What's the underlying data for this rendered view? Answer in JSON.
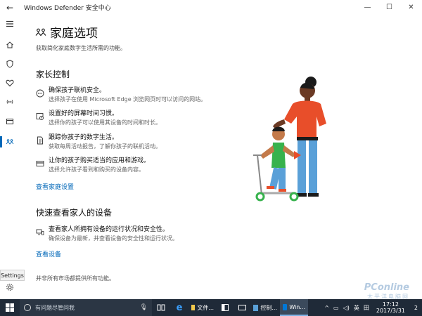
{
  "window": {
    "title": "Windows Defender 安全中心",
    "back_glyph": "←",
    "min_glyph": "—",
    "max_glyph": "☐",
    "close_glyph": "✕"
  },
  "rail": {
    "items": [
      "menu-icon",
      "home-icon",
      "shield-icon",
      "heart-icon",
      "wifi-icon",
      "browser-icon",
      "family-icon"
    ],
    "active_index": 6,
    "settings_tooltip": "Settings"
  },
  "page": {
    "title": "家庭选项",
    "subtitle": "获取简化家庭数字生活所需的功能。"
  },
  "parental": {
    "title": "家长控制",
    "items": [
      {
        "icon": "ellipsis-circle-icon",
        "title": "确保孩子联机安全。",
        "desc": "选择孩子在使用 Microsoft Edge 浏览网页时可以访问的网站。"
      },
      {
        "icon": "clock-icon",
        "title": "设置好的屏幕时间习惯。",
        "desc": "选择你的孩子可以使用其设备的时间和时长。"
      },
      {
        "icon": "document-icon",
        "title": "跟踪你孩子的数字生活。",
        "desc": "获取每周活动报告，了解你孩子的联机活动。"
      },
      {
        "icon": "card-icon",
        "title": "让你的孩子购买适当的应用和游戏。",
        "desc": "选择允许孩子看到和购买的设备内容。"
      }
    ],
    "link": "查看家庭设置"
  },
  "devices": {
    "title": "快速查看家人的设备",
    "item": {
      "icon": "devices-icon",
      "title": "查看家人所拥有设备的运行状况和安全性。",
      "desc": "确保设备为最新，并查看设备的安全性和运行状况。"
    },
    "link": "查看设备"
  },
  "footer_note": "并非所有市场都提供所有功能。",
  "watermark": {
    "logo": "PConline",
    "sub": "太平洋电脑网"
  },
  "taskbar": {
    "search_text": "有问题尽管问我",
    "apps": [
      {
        "name": "task-view-icon",
        "label": ""
      },
      {
        "name": "edge-icon",
        "label": "e"
      },
      {
        "name": "explorer-app",
        "label": "文件..."
      },
      {
        "name": "store-icon",
        "label": ""
      },
      {
        "name": "mail-icon",
        "label": ""
      },
      {
        "name": "control-panel-app",
        "label": "控制..."
      },
      {
        "name": "defender-app",
        "label": "Win..."
      }
    ],
    "tray_lang": "英",
    "tray_ime": "田",
    "time": "17:12",
    "date": "2017/3/31",
    "notify_count": "2"
  },
  "colors": {
    "accent": "#0067b8",
    "taskbar": "#1f2a38",
    "illus_orange": "#e84e2a",
    "illus_green": "#37b24d",
    "illus_blue": "#5aa0d8"
  }
}
